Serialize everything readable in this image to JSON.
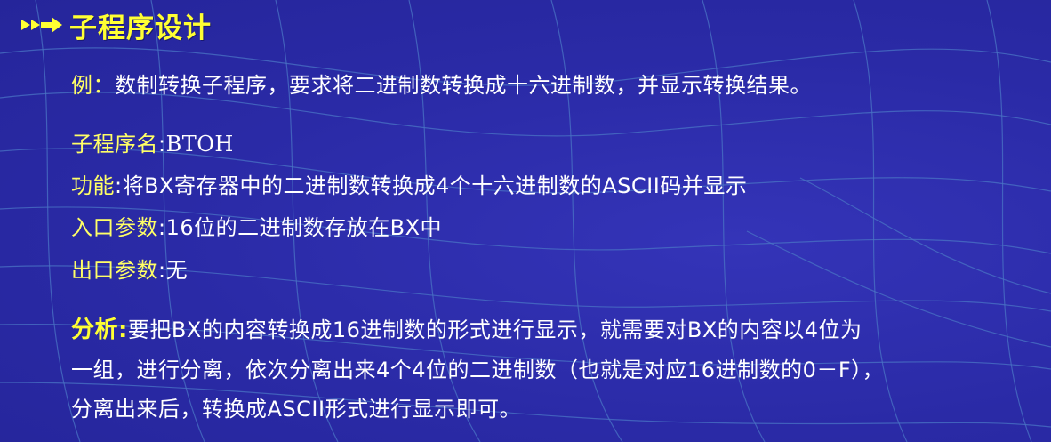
{
  "header": {
    "title": "子程序设计"
  },
  "example": {
    "label": "例",
    "separator": "：",
    "text": "数制转换子程序，要求将二进制数转换成十六进制数，并显示转换结果。"
  },
  "subroutine": {
    "name_label": "子程序名",
    "name_value": "BTOH",
    "function_label": "功能",
    "function_value": "将BX寄存器中的二进制数转换成4个十六进制数的ASCII码并显示",
    "entry_label": "入口参数",
    "entry_value": "16位的二进制数存放在BX中",
    "exit_label": "出口参数",
    "exit_value": "无",
    "colon": ":"
  },
  "analysis": {
    "label": "分析",
    "colon": ":",
    "line1": "要把BX的内容转换成16进制数的形式进行显示，就需要对BX的内容以4位为",
    "line2": "一组，进行分离，依次分离出来4个4位的二进制数（也就是对应16进制数的0－F），",
    "line3": "分离出来后，转换成ASCII形式进行显示即可。"
  },
  "colors": {
    "background": "#2b2ba8",
    "title": "#ffff33",
    "label": "#ffff66",
    "text": "#ffffff",
    "grid": "#4a74c4"
  },
  "icons": {
    "title_bullet": "double-arrow-bullet-icon"
  }
}
